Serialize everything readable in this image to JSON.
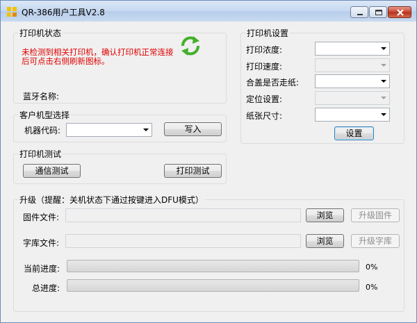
{
  "window": {
    "title": "QR-386用户工具V2.8"
  },
  "printer_status": {
    "group_label": "打印机状态",
    "message_line1": "未检测到相关打印机，确认打印机正常连接",
    "message_line2": "后可点击右侧刷新图标。",
    "bluetooth_label": "蓝牙名称:"
  },
  "model_select": {
    "group_label": "客户机型选择",
    "machine_code_label": "机器代码:",
    "machine_code_value": "",
    "write_button": "写入"
  },
  "printer_test": {
    "group_label": "打印机测试",
    "comm_test_button": "通信测试",
    "print_test_button": "打印测试"
  },
  "printer_settings": {
    "group_label": "打印机设置",
    "density_label": "打印浓度:",
    "speed_label": "打印速度:",
    "cover_feed_label": "合盖是否走纸:",
    "positioning_label": "定位设置:",
    "paper_size_label": "纸张尺寸:",
    "set_button": "设置"
  },
  "upgrade": {
    "group_label": "升级（提醒：关机状态下通过按键进入DFU模式）",
    "firmware_label": "固件文件:",
    "firmware_path": "",
    "font_label": "字库文件:",
    "font_path": "",
    "browse_button": "浏览",
    "upgrade_firmware_button": "升级固件",
    "upgrade_font_button": "升级字库",
    "current_progress_label": "当前进度:",
    "total_progress_label": "总进度:",
    "current_progress": 0,
    "total_progress": 0,
    "current_progress_text": "0%",
    "total_progress_text": "0%"
  },
  "colors": {
    "error_text": "#e00000",
    "progress_fill": "#37c837",
    "refresh_icon": "#43b02a"
  }
}
